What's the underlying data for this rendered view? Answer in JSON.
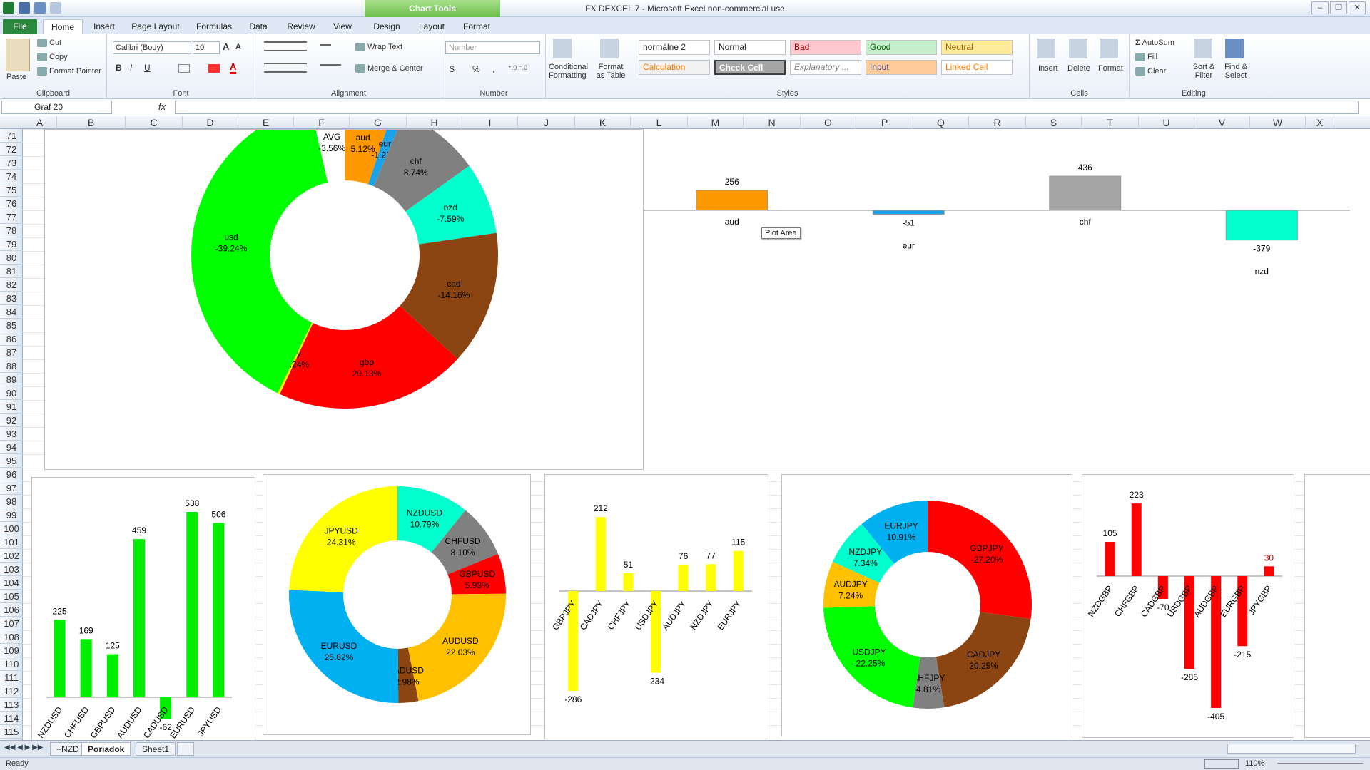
{
  "window": {
    "title": "FX DEXCEL 7  -  Microsoft Excel non-commercial use",
    "context_tab": "Chart Tools"
  },
  "tabs": [
    "File",
    "Home",
    "Insert",
    "Page Layout",
    "Formulas",
    "Data",
    "Review",
    "View",
    "Design",
    "Layout",
    "Format"
  ],
  "ribbon": {
    "clipboard": {
      "paste": "Paste",
      "cut": "Cut",
      "copy": "Copy",
      "format_painter": "Format Painter",
      "label": "Clipboard"
    },
    "font": {
      "name": "Calibri (Body)",
      "size": "10",
      "bold": "B",
      "italic": "I",
      "underline": "U",
      "label": "Font"
    },
    "alignment": {
      "wrap": "Wrap Text",
      "merge": "Merge & Center",
      "label": "Alignment"
    },
    "number": {
      "format": "Number",
      "currency": "$",
      "percent": "%",
      "comma": ",",
      "label": "Number"
    },
    "styles": {
      "conditional": "Conditional Formatting",
      "format_table": "Format as Table",
      "items": [
        "normálne 2",
        "Normal",
        "Bad",
        "Good",
        "Neutral",
        "Calculation",
        "Check Cell",
        "Explanatory ...",
        "Input",
        "Linked Cell"
      ],
      "label": "Styles"
    },
    "cells": {
      "insert": "Insert",
      "delete": "Delete",
      "format": "Format",
      "label": "Cells"
    },
    "editing": {
      "autosum": "AutoSum",
      "fill": "Fill",
      "clear": "Clear",
      "sort": "Sort & Filter",
      "find": "Find & Select",
      "label": "Editing"
    }
  },
  "formula_bar": {
    "name_box": "Graf 20",
    "fx": "fx",
    "value": ""
  },
  "columns": [
    "A",
    "B",
    "C",
    "D",
    "E",
    "F",
    "G",
    "H",
    "I",
    "J",
    "K",
    "L",
    "M",
    "N",
    "O",
    "P",
    "Q",
    "R",
    "S",
    "T",
    "U",
    "V",
    "W",
    "X"
  ],
  "rows": [
    "71",
    "72",
    "73",
    "74",
    "75",
    "76",
    "77",
    "78",
    "79",
    "80",
    "81",
    "82",
    "83",
    "84",
    "85",
    "86",
    "87",
    "88",
    "89",
    "90",
    "91",
    "92",
    "93",
    "94",
    "95",
    "96",
    "97",
    "98",
    "99",
    "100",
    "101",
    "102",
    "103",
    "104",
    "105",
    "106",
    "107",
    "108",
    "109",
    "110",
    "111",
    "112",
    "113",
    "114",
    "115"
  ],
  "tooltip": "Plot Area",
  "sheet_tabs": [
    "+NZD",
    "Poriadok",
    "Sheet1"
  ],
  "status": {
    "ready": "Ready",
    "zoom": "110%"
  },
  "chart_data": [
    {
      "type": "pie",
      "id": "main-donut",
      "slices": [
        {
          "label": "aud",
          "value": "5.12%",
          "share": 5.12,
          "color": "#ff9900"
        },
        {
          "label": "eur",
          "value": "-1.22%",
          "share": 1.22,
          "color": "#1aa3e8"
        },
        {
          "label": "chf",
          "value": "8.74%",
          "share": 8.74,
          "color": "#808080"
        },
        {
          "label": "nzd",
          "value": "-7.59%",
          "share": 7.59,
          "color": "#00ffcc"
        },
        {
          "label": "cad",
          "value": "-14.16%",
          "share": 14.16,
          "color": "#8b4513"
        },
        {
          "label": "gbp",
          "value": "20.13%",
          "share": 20.13,
          "color": "#ff0000"
        },
        {
          "label": "jpy",
          "value": "-0.24%",
          "share": 0.24,
          "color": "#ffff00"
        },
        {
          "label": "usd",
          "value": "-39.24%",
          "share": 39.24,
          "color": "#00ff00"
        },
        {
          "label": "AVG",
          "value": "-3.56%",
          "share": 3.56,
          "color": "#ffffff"
        }
      ]
    },
    {
      "type": "bar",
      "id": "top-bar",
      "categories": [
        "aud",
        "eur",
        "chf",
        "nzd"
      ],
      "values": [
        256,
        -51,
        436,
        -379
      ],
      "labels": [
        "256",
        "-51",
        "436",
        "-379"
      ],
      "colors": [
        "#ff9900",
        "#1aa3e8",
        "#a6a6a6",
        "#00ffcc"
      ]
    },
    {
      "type": "bar",
      "id": "usd-bar",
      "categories": [
        "NZDUSD",
        "CHFUSD",
        "GBPUSD",
        "AUDUSD",
        "CADUSD",
        "EURUSD",
        "JPYUSD"
      ],
      "values": [
        225,
        169,
        125,
        459,
        -62,
        538,
        506
      ],
      "labels": [
        "225",
        "169",
        "125",
        "459",
        "-62",
        "538",
        "506"
      ],
      "color": "#00ee00"
    },
    {
      "type": "pie",
      "id": "usd-donut",
      "slices": [
        {
          "label": "NZDUSD",
          "value": "10.79%",
          "share": 10.79,
          "color": "#00ffcc"
        },
        {
          "label": "CHFUSD",
          "value": "8.10%",
          "share": 8.1,
          "color": "#808080"
        },
        {
          "label": "GBPUSD",
          "value": "5.98%",
          "share": 5.98,
          "color": "#ff0000"
        },
        {
          "label": "AUDUSD",
          "value": "22.03%",
          "share": 22.03,
          "color": "#ffc000"
        },
        {
          "label": "CADUSD",
          "value": "-2.98%",
          "share": 2.98,
          "color": "#8b4513"
        },
        {
          "label": "EURUSD",
          "value": "25.82%",
          "share": 25.82,
          "color": "#00b0f0"
        },
        {
          "label": "JPYUSD",
          "value": "24.31%",
          "share": 24.31,
          "color": "#ffff00"
        }
      ]
    },
    {
      "type": "bar",
      "id": "jpy-bar",
      "categories": [
        "GBPJPY",
        "CADJPY",
        "CHFJPY",
        "USDJPY",
        "AUDJPY",
        "NZDJPY",
        "EURJPY"
      ],
      "values": [
        -286,
        212,
        51,
        -234,
        76,
        77,
        115
      ],
      "labels": [
        "-286",
        "212",
        "51",
        "-234",
        "76",
        "77",
        "115"
      ],
      "color": "#ffff00"
    },
    {
      "type": "pie",
      "id": "jpy-donut",
      "slices": [
        {
          "label": "GBPJPY",
          "value": "-27.20%",
          "share": 27.2,
          "color": "#ff0000"
        },
        {
          "label": "CADJPY",
          "value": "20.25%",
          "share": 20.25,
          "color": "#8b4513"
        },
        {
          "label": "CHFJPY",
          "value": "4.81%",
          "share": 4.81,
          "color": "#808080"
        },
        {
          "label": "USDJPY",
          "value": "-22.25%",
          "share": 22.25,
          "color": "#00ff00"
        },
        {
          "label": "AUDJPY",
          "value": "7.24%",
          "share": 7.24,
          "color": "#ffc000"
        },
        {
          "label": "NZDJPY",
          "value": "7.34%",
          "share": 7.34,
          "color": "#00ffcc"
        },
        {
          "label": "EURJPY",
          "value": "10.91%",
          "share": 10.91,
          "color": "#00b0f0"
        }
      ]
    },
    {
      "type": "bar",
      "id": "gbp-bar",
      "categories": [
        "NZDGBP",
        "CHFGBP",
        "CADGBP",
        "USDGBP",
        "AUDGBP",
        "EURGBP",
        "JPYGBP"
      ],
      "values": [
        105,
        223,
        -70,
        -285,
        -405,
        -215,
        30
      ],
      "labels": [
        "105",
        "223",
        "-70",
        "-285",
        "-405",
        "-215",
        "30"
      ],
      "color": "#ff0000"
    }
  ]
}
